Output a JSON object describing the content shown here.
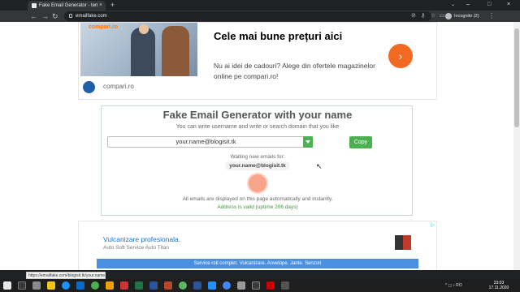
{
  "browser": {
    "tab_title": "Fake Email Generator - temp m...",
    "tab_close": "×",
    "new_tab": "+",
    "url": "emailfake.com",
    "profile_label": "Incognito (2)",
    "window_controls": [
      "–",
      "□",
      "×"
    ]
  },
  "ad_top": {
    "brand": "compari.ro",
    "title": "Cele mai bune prețuri aici",
    "text": "Nu ai idei de cadouri? Alege din ofertele magazinelor online pe compari.ro!",
    "site": "compari.ro",
    "arrow": "›"
  },
  "generator": {
    "title": "Fake Email Generator with your name",
    "subtitle": "You can write username and write or search domain that you like",
    "email_value": "your.name@blogisit.tk",
    "copy_label": "Copy",
    "waiting_label": "Waiting new emails for:",
    "waiting_address": "your.name@blogisit.tk",
    "note": "All emails are displayed on this page automatically and instantly.",
    "validity": "Address is valid (uptime 206 days)"
  },
  "ad_bottom": {
    "title": "Vulcanizare profesionala.",
    "subtitle": "Auto Soft Service Auto Titan",
    "bar_text": "Service roti complet. Vulcanizare. Anvelope. Jante. Senzori",
    "adchoice": "▷"
  },
  "status_url": "https://emailfake.com/blogisit.tk/your.name",
  "taskbar": {
    "tray": "^ ◻ ♪ RO",
    "time": "23:03",
    "date": "17.11.2020"
  },
  "colors": {
    "accent_green": "#4caf50",
    "ad_orange": "#f26a21",
    "link_blue": "#1a6fc9"
  }
}
